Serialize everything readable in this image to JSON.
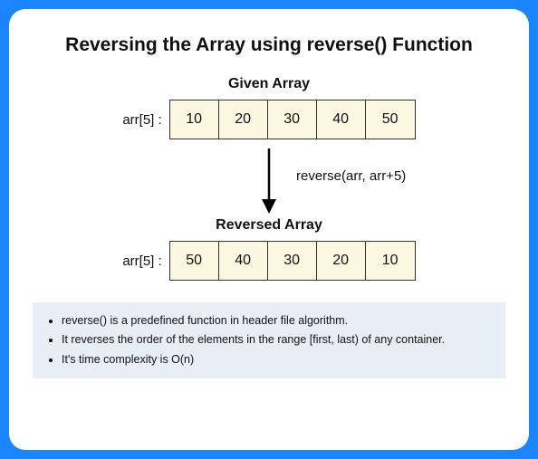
{
  "title": "Reversing the Array using reverse() Function",
  "given": {
    "label": "Given Array",
    "name": "arr[5] :",
    "values": [
      "10",
      "20",
      "30",
      "40",
      "50"
    ]
  },
  "arrow_label": "reverse(arr, arr+5)",
  "reversed": {
    "label": "Reversed Array",
    "name": "arr[5] :",
    "values": [
      "50",
      "40",
      "30",
      "20",
      "10"
    ]
  },
  "notes": [
    "reverse() is a predefined function in header file algorithm.",
    "It reverses the order of the elements in the range [first, last) of any container.",
    "It's time complexity is O(n)"
  ]
}
